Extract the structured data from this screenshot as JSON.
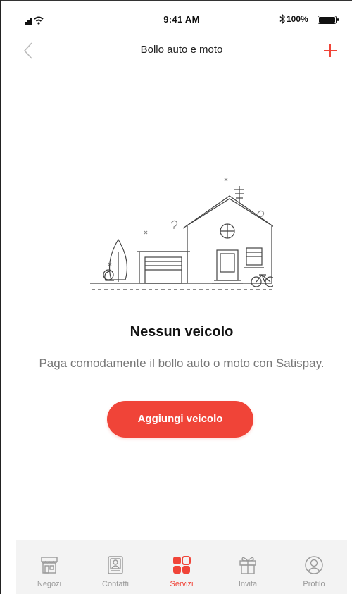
{
  "status_bar": {
    "time": "9:41 AM",
    "battery": "100%"
  },
  "navbar": {
    "title": "Bollo auto e moto"
  },
  "empty_state": {
    "title": "Nessun veicolo",
    "subtitle": "Paga comodamente il bollo auto o moto con Satispay.",
    "button_label": "Aggiungi veicolo"
  },
  "tab_bar": {
    "tabs": [
      {
        "label": "Negozi",
        "icon": "store-icon",
        "active": false
      },
      {
        "label": "Contatti",
        "icon": "contacts-icon",
        "active": false
      },
      {
        "label": "Servizi",
        "icon": "services-icon",
        "active": true
      },
      {
        "label": "Invita",
        "icon": "gift-icon",
        "active": false
      },
      {
        "label": "Profilo",
        "icon": "profile-icon",
        "active": false
      }
    ]
  },
  "colors": {
    "accent": "#f04438",
    "text_primary": "#111111",
    "text_secondary": "#777777",
    "tab_inactive": "#999999",
    "tab_bar_bg": "#f3f3f3"
  }
}
